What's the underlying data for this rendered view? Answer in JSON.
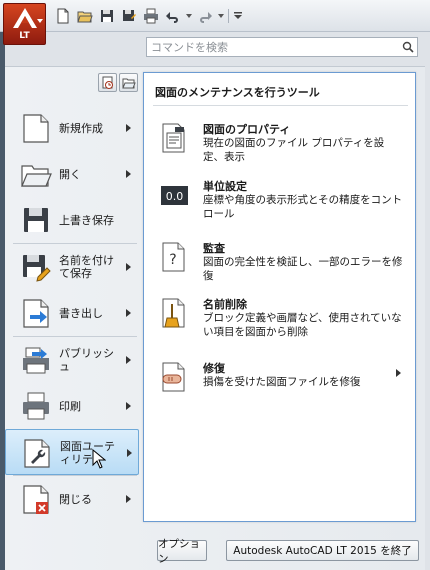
{
  "app_button": {
    "badge": "LT"
  },
  "search": {
    "placeholder": "コマンドを検索"
  },
  "menu": {
    "items": [
      {
        "label": "新規作成",
        "has_arrow": true
      },
      {
        "label": "開く",
        "has_arrow": true
      },
      {
        "label": "上書き保存",
        "has_arrow": false
      },
      {
        "label": "名前を付けて保存",
        "has_arrow": true
      },
      {
        "label": "書き出し",
        "has_arrow": true
      },
      {
        "label": "パブリッシュ",
        "has_arrow": true
      },
      {
        "label": "印刷",
        "has_arrow": true
      },
      {
        "label": "図面ユーティリティ",
        "has_arrow": true,
        "active": true
      },
      {
        "label": "閉じる",
        "has_arrow": true
      }
    ]
  },
  "flyout": {
    "title": "図面のメンテナンスを行うツール",
    "items": [
      {
        "title": "図面のプロパティ",
        "desc": "現在の図面のファイル プロパティを設定、表示",
        "icon": "drawing-properties-icon"
      },
      {
        "title": "単位設定",
        "desc": "座標や角度の表示形式とその精度をコントロール",
        "icon": "units-icon",
        "icon_text": "0.0"
      },
      {
        "title": "監査",
        "desc": "図面の完全性を検証し、一部のエラーを修復",
        "icon": "audit-icon",
        "icon_text": "?"
      },
      {
        "title": "名前削除",
        "desc": "ブロック定義や画層など、使用されていない項目を図面から削除",
        "icon": "purge-icon"
      },
      {
        "title": "修復",
        "desc": "損傷を受けた図面ファイルを修復",
        "icon": "recover-icon",
        "has_arrow": true
      }
    ]
  },
  "footer": {
    "options_label": "オプション",
    "exit_label": "Autodesk AutoCAD LT 2015 を終了"
  },
  "colors": {
    "accent": "#6fa9d8",
    "app_button": "#c23a1a",
    "flyout_border": "#6b9bd2"
  }
}
